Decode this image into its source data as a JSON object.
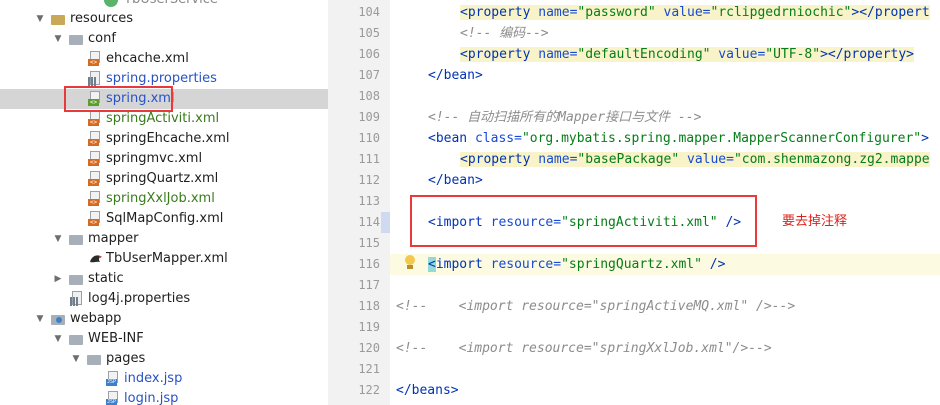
{
  "tree": {
    "items": [
      {
        "label": "TbUserService",
        "color": "default",
        "icon": "java-interface-icon"
      },
      {
        "label": "resources",
        "color": "default",
        "icon": "folder-icon"
      },
      {
        "label": "conf",
        "color": "default",
        "icon": "folder-icon"
      },
      {
        "label": "ehcache.xml",
        "color": "default",
        "icon": "xml-file-icon"
      },
      {
        "label": "spring.properties",
        "color": "blue",
        "icon": "properties-file-icon"
      },
      {
        "label": "spring.xml",
        "color": "blue",
        "icon": "xml-file-icon",
        "selected": true
      },
      {
        "label": "springActiviti.xml",
        "color": "green",
        "icon": "xml-file-icon"
      },
      {
        "label": "springEhcache.xml",
        "color": "default",
        "icon": "xml-file-icon"
      },
      {
        "label": "springmvc.xml",
        "color": "default",
        "icon": "xml-file-icon"
      },
      {
        "label": "springQuartz.xml",
        "color": "default",
        "icon": "xml-file-icon"
      },
      {
        "label": "springXxlJob.xml",
        "color": "green",
        "icon": "xml-file-icon"
      },
      {
        "label": "SqlMapConfig.xml",
        "color": "default",
        "icon": "xml-file-icon"
      },
      {
        "label": "mapper",
        "color": "default",
        "icon": "folder-icon"
      },
      {
        "label": "TbUserMapper.xml",
        "color": "default",
        "icon": "mybatis-file-icon"
      },
      {
        "label": "static",
        "color": "default",
        "icon": "folder-icon"
      },
      {
        "label": "log4j.properties",
        "color": "default",
        "icon": "properties-file-icon"
      },
      {
        "label": "webapp",
        "color": "default",
        "icon": "web-folder-icon"
      },
      {
        "label": "WEB-INF",
        "color": "default",
        "icon": "folder-icon"
      },
      {
        "label": "pages",
        "color": "default",
        "icon": "folder-icon"
      },
      {
        "label": "index.jsp",
        "color": "blue",
        "icon": "jsp-file-icon"
      },
      {
        "label": "login.jsp",
        "color": "blue",
        "icon": "jsp-file-icon"
      }
    ]
  },
  "editor": {
    "line_numbers": [
      "104",
      "105",
      "106",
      "107",
      "108",
      "109",
      "110",
      "111",
      "112",
      "113",
      "114",
      "115",
      "116",
      "117",
      "118",
      "119",
      "120",
      "121",
      "122"
    ],
    "lines": {
      "l104": {
        "tag_open": "<property ",
        "a1": "name=",
        "v1": "\"password\"",
        "a2": " value=",
        "v2": "\"rclipgedrniochic\"",
        "tail": "></propert"
      },
      "l105": {
        "comment": "<!-- 编码-->"
      },
      "l106": {
        "tag_open": "<property ",
        "a1": "name=",
        "v1": "\"defaultEncoding\"",
        "a2": " value=",
        "v2": "\"UTF-8\"",
        "tail": "></property>"
      },
      "l107": {
        "text": "</bean>"
      },
      "l109": {
        "comment": "<!-- 自动扫描所有的Mapper接口与文件 -->"
      },
      "l110": {
        "tag_open": "<bean ",
        "a1": "class=",
        "v1": "\"org.mybatis.spring.mapper.MapperScannerConfigurer\"",
        "tail": ">"
      },
      "l111": {
        "tag_open": "<property ",
        "a1": "name=",
        "v1": "\"basePackage\"",
        "a2": " value=",
        "v2": "\"com.shenmazong.zg2.mappe"
      },
      "l112": {
        "text": "</bean>"
      },
      "l114": {
        "tag_open": "<import ",
        "a1": "resource=",
        "v1": "\"springActiviti.xml\"",
        "tail": " />"
      },
      "l116": {
        "tag_open": "<import ",
        "a1": "resource=",
        "v1": "\"springQuartz.xml\"",
        "tail": " />"
      },
      "l118": {
        "comment": "<!--    <import resource=\"springActiveMQ.xml\" />-->"
      },
      "l120": {
        "comment": "<!--    <import resource=\"springXxlJob.xml\"/>-->"
      },
      "l122": {
        "text": "</beans>"
      }
    },
    "annotation": "要去掉注释"
  },
  "colors": {
    "highlight_box": "#e83a3a",
    "tag_blue": "#0033b3",
    "attr_value_green": "#067d17",
    "comment_gray": "#8c8c8c",
    "selected_row": "#d5d5d5"
  }
}
